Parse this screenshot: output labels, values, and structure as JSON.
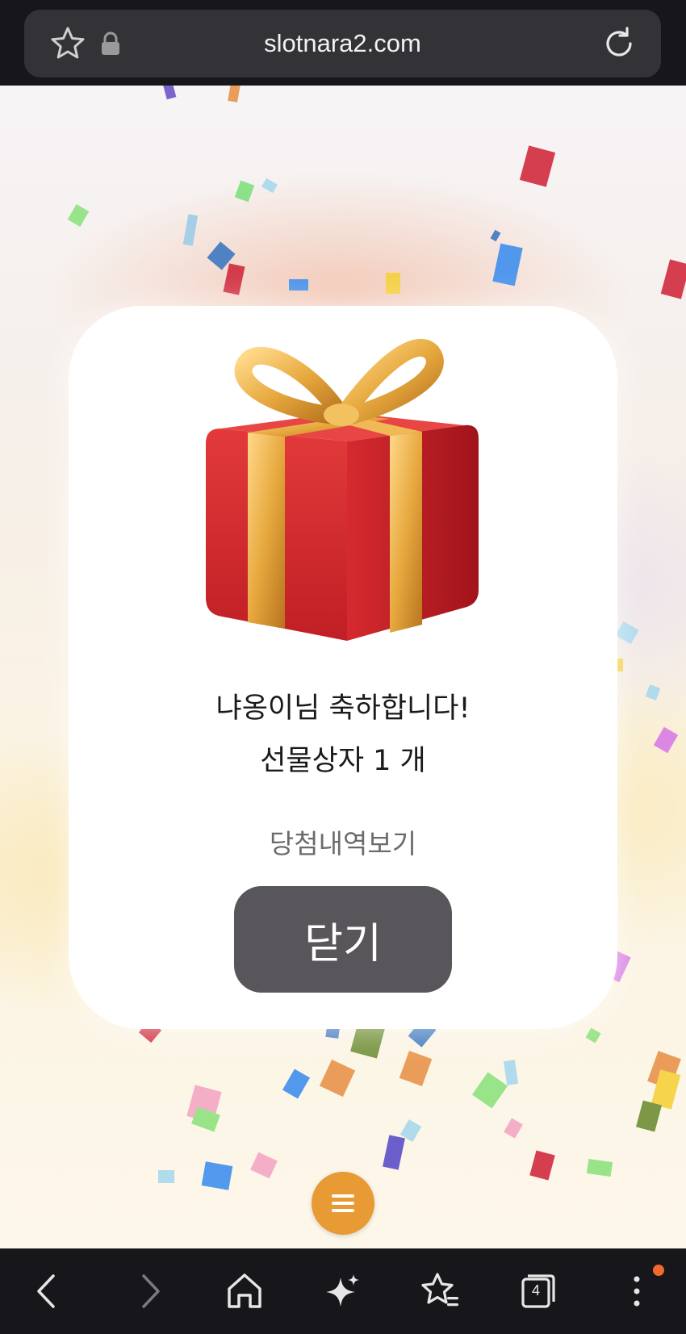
{
  "browser": {
    "url": "slotnara2.com",
    "open_tabs": "4"
  },
  "dialog": {
    "congrats_text": "냐옹이님 축하합니다!",
    "prize_text": "선물상자 1 개",
    "history_link": "당첨내역보기",
    "close_label": "닫기"
  },
  "icons": {
    "top": [
      "star-icon",
      "lock-icon",
      "reload-icon"
    ],
    "bottom": [
      "back-icon",
      "forward-icon",
      "home-icon",
      "sparkle-icon",
      "bookmarks-icon",
      "tabs-icon",
      "more-icon"
    ],
    "fab": "menu-icon",
    "illustration": "gift-box-icon"
  },
  "colors": {
    "close_button": "#58565a",
    "fab": "#e89a34",
    "notification_dot": "#ef6a2c"
  }
}
